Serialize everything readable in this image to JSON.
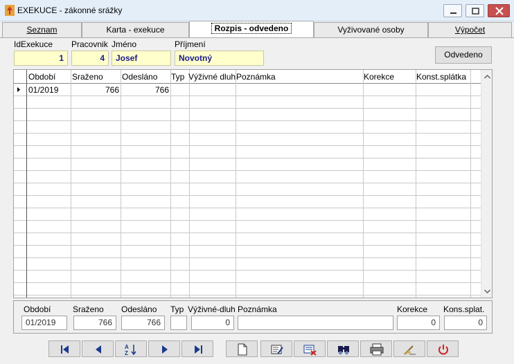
{
  "window": {
    "title": "EXEKUCE - zákonné srážky"
  },
  "tabs": [
    {
      "label": "Seznam"
    },
    {
      "label": "Karta - exekuce"
    },
    {
      "label": "Rozpis - odvedeno"
    },
    {
      "label": "Vyživované osoby"
    },
    {
      "label": "Výpočet"
    }
  ],
  "header": {
    "id_label": "IdExekuce",
    "id_value": "1",
    "pracovnik_label": "Pracovnik",
    "pracovnik_value": "4",
    "jmeno_label": "Jméno",
    "jmeno_value": "Josef",
    "prijmeni_label": "Příjmení",
    "prijmeni_value": "Novotný",
    "odvedeno_button": "Odvedeno"
  },
  "grid": {
    "columns": [
      "Období",
      "Sraženo",
      "Odesláno",
      "Typ",
      "Výživné dluh",
      "Poznámka",
      "Korekce",
      "Konst.splátka"
    ],
    "rows": [
      {
        "obdobi": "01/2019",
        "srazeno": "766",
        "odeslano": "766",
        "typ": "",
        "vyzivne": "",
        "poznamka": "",
        "korekce": "",
        "konst": ""
      }
    ]
  },
  "detail": {
    "obdobi_label": "Období",
    "obdobi_value": "01/2019",
    "srazeno_label": "Sraženo",
    "srazeno_value": "766",
    "odeslano_label": "Odesláno",
    "odeslano_value": "766",
    "typ_label": "Typ",
    "typ_value": "",
    "vyzivne_label": "Výživné-dluh",
    "vyzivne_value": "0",
    "poznamka_label": "Poznámka",
    "poznamka_value": "",
    "korekce_label": "Korekce",
    "korekce_value": "0",
    "konst_label": "Kons.splat.",
    "konst_value": "0"
  },
  "toolbar": {
    "icons": [
      "first-record-icon",
      "previous-record-icon",
      "sort-icon",
      "next-record-icon",
      "last-record-icon",
      "new-record-icon",
      "edit-record-icon",
      "delete-record-icon",
      "search-icon",
      "print-icon",
      "cleanup-icon",
      "exit-icon"
    ]
  }
}
